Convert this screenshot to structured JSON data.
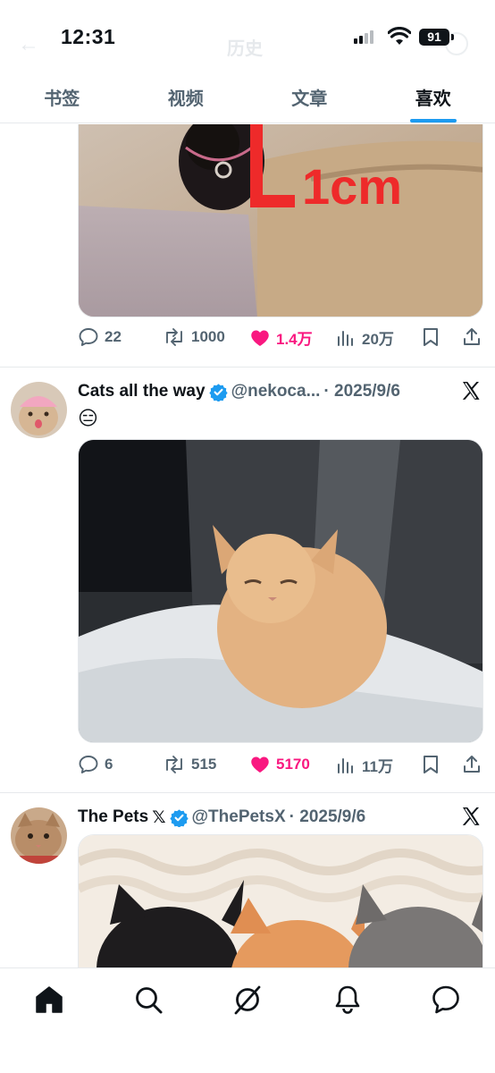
{
  "status": {
    "time": "12:31",
    "battery": "91"
  },
  "faded_header": {
    "title": "历史"
  },
  "tabs": [
    {
      "label": "书签",
      "active": false
    },
    {
      "label": "视频",
      "active": false
    },
    {
      "label": "文章",
      "active": false
    },
    {
      "label": "喜欢",
      "active": true
    }
  ],
  "tweets": [
    {
      "media_overlay_text": "1cm",
      "stats": {
        "replies": "22",
        "retweets": "1000",
        "likes": "1.4万",
        "views": "20万"
      }
    },
    {
      "name": "Cats all the way",
      "handle": "@nekoca...",
      "date": "· 2025/9/6",
      "text": "😑",
      "stats": {
        "replies": "6",
        "retweets": "515",
        "likes": "5170",
        "views": "11万"
      }
    },
    {
      "name": "The Pets",
      "name_suffix": "𝕏",
      "handle": "@ThePetsX",
      "date": "· 2025/9/6"
    }
  ],
  "colors": {
    "accent": "#1d9bf0",
    "like": "#f91880",
    "muted": "#536471",
    "text": "#0f1419"
  },
  "bottom_nav": [
    "home-icon",
    "search-icon",
    "grok-icon",
    "notifications-icon",
    "messages-icon"
  ]
}
